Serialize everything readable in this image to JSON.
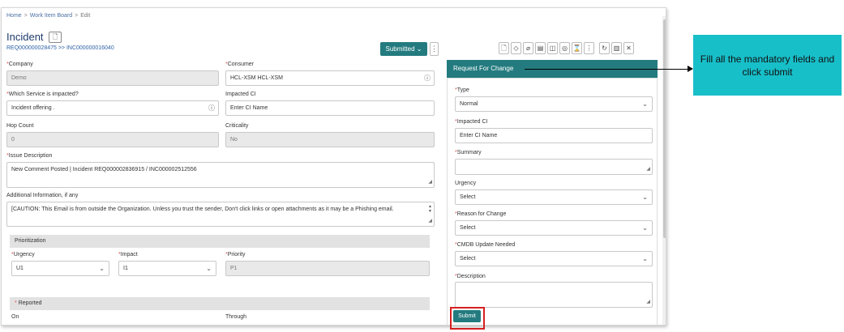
{
  "breadcrumb": {
    "home": "Home",
    "board": "Work Item Board",
    "current": "Edit",
    "sep": ">"
  },
  "header": {
    "title": "Incident",
    "ref": "REQ000000028475 >> INC000000016040",
    "status": "Submitted",
    "status_chevron": "⌄",
    "kebab": "⋮"
  },
  "toolbar_icons": [
    "🗋",
    "◇",
    "⌀",
    "▤",
    "◫",
    "◎",
    "⌛",
    "⋮",
    "↻",
    "▥",
    "✕"
  ],
  "form": {
    "company_label": "Company",
    "company_value": "Demo",
    "consumer_label": "Consumer",
    "consumer_value": "HCL-XSM HCL-XSM",
    "service_label": "Which Service is impacted?",
    "service_value": "Incident offering .",
    "impacted_ci_label": "Impacted CI",
    "impacted_ci_placeholder": "Enter CI Name",
    "hop_label": "Hop Count",
    "hop_value": "0",
    "criticality_label": "Criticality",
    "criticality_value": "No",
    "issue_label": "Issue Description",
    "issue_value": "New Comment Posted | Incident REQ000002836915 / INC000002512556",
    "addinfo_label": "Additional Information, if any",
    "addinfo_value": "[CAUTION: This Email is from outside the Organization. Unless you trust the sender, Don't click links or open attachments as it may be a Phishing email.",
    "prioritization_label": "Prioritization",
    "urgency_label": "Urgency",
    "urgency_value": "U1",
    "impact_label": "Impact",
    "impact_value": "I1",
    "priority_label": "Priority",
    "priority_value": "P1",
    "reported_label": "Reported",
    "on_label": "On",
    "through_label": "Through"
  },
  "rfc": {
    "title": "Request For Change",
    "type_label": "Type",
    "type_value": "Normal",
    "ci_label": "Impacted CI",
    "ci_placeholder": "Enter CI Name",
    "summary_label": "Summary",
    "urgency_label": "Urgency",
    "urgency_value": "Select",
    "reason_label": "Reason for Change",
    "reason_value": "Select",
    "cmdb_label": "CMDB Update Needed",
    "cmdb_value": "Select",
    "description_label": "Description",
    "submit_label": "Submit"
  },
  "callout": {
    "text": "Fill all the mandatory fields and click submit"
  },
  "colors": {
    "accent": "#237b7f",
    "callout": "#17bfc9",
    "highlight": "#d62020",
    "required": "#d9534f"
  }
}
